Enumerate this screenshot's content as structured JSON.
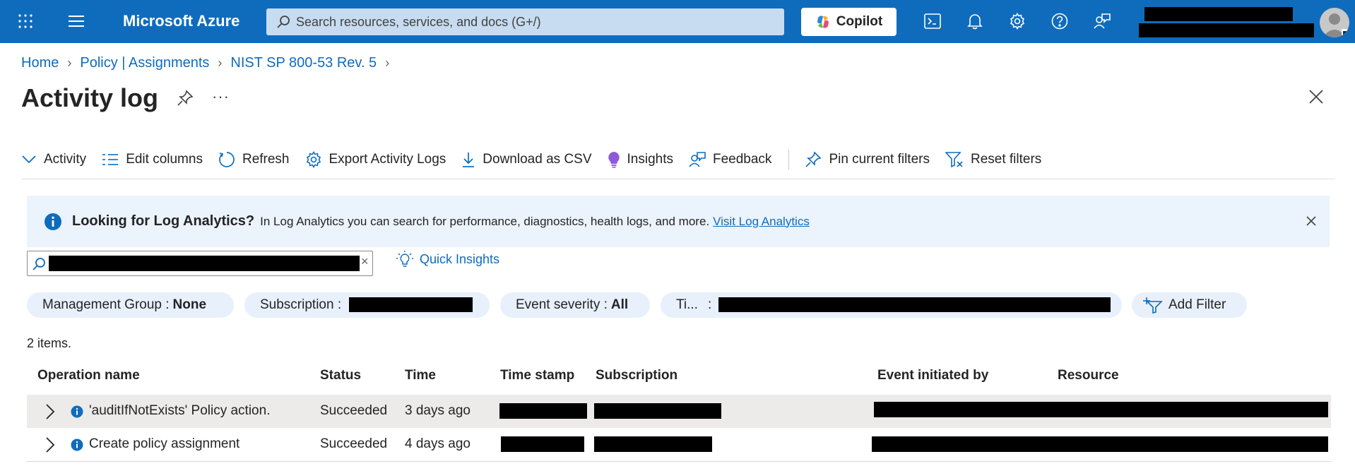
{
  "topbar": {
    "brand": "Microsoft Azure",
    "search_placeholder": "Search resources, services, and docs (G+/)",
    "copilot_label": "Copilot",
    "colors": {
      "bar": "#0f6cbd",
      "search": "#c7dcf0"
    }
  },
  "breadcrumb": {
    "items": [
      "Home",
      "Policy | Assignments",
      "NIST SP 800-53 Rev. 5"
    ]
  },
  "page": {
    "title": "Activity log",
    "more_label": "···"
  },
  "toolbar": {
    "activity": "Activity",
    "edit_columns": "Edit columns",
    "refresh": "Refresh",
    "export": "Export Activity Logs",
    "download": "Download as CSV",
    "insights": "Insights",
    "feedback": "Feedback",
    "pin_filters": "Pin current filters",
    "reset_filters": "Reset filters"
  },
  "banner": {
    "heading": "Looking for Log Analytics?",
    "text": "In Log Analytics you can search for performance, diagnostics, health logs, and more.",
    "link": "Visit Log Analytics"
  },
  "quick_insights": "Quick Insights",
  "filters": {
    "management_group_label": "Management Group :",
    "management_group_value": "None",
    "subscription_label": "Subscription :",
    "severity_label": "Event severity :",
    "severity_value": "All",
    "time_label": "Ti...",
    "time_colon": ":",
    "add_filter": "Add Filter"
  },
  "results": {
    "count": "2 items."
  },
  "columns": [
    "Operation name",
    "Status",
    "Time",
    "Time stamp",
    "Subscription",
    "Event initiated by",
    "Resource"
  ],
  "rows": [
    {
      "operation": "'auditIfNotExists' Policy action.",
      "status": "Succeeded",
      "time": "3 days ago"
    },
    {
      "operation": "Create policy assignment",
      "status": "Succeeded",
      "time": "4 days ago"
    }
  ]
}
